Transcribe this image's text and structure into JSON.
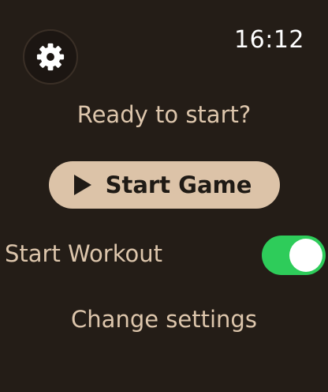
{
  "header": {
    "time": "16:12",
    "settings_icon": "gear-icon"
  },
  "main": {
    "prompt": "Ready to start?",
    "start_button": {
      "label": "Start Game",
      "icon": "play-icon"
    },
    "workout": {
      "label": "Start Workout",
      "toggle_on": true
    },
    "change_settings_label": "Change settings"
  },
  "colors": {
    "background": "#241d17",
    "text": "#ddc6ac",
    "button_bg": "#dcc3a8",
    "toggle_on": "#2ecc5a"
  }
}
